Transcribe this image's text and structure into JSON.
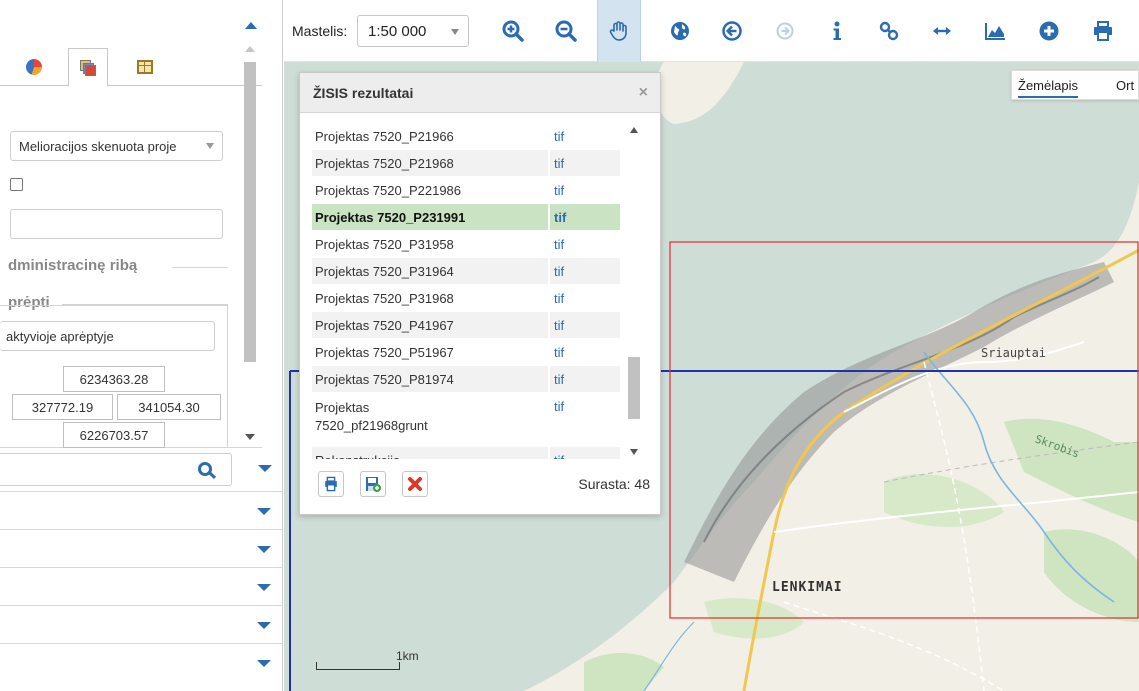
{
  "toolbar": {
    "scale_label": "Mastelis:",
    "scale_value": "1:50 000",
    "tools": [
      {
        "name": "zoom-in-icon"
      },
      {
        "name": "zoom-out-icon"
      },
      {
        "name": "pan-hand-icon"
      },
      {
        "name": "globe-icon"
      },
      {
        "name": "back-icon"
      },
      {
        "name": "forward-icon"
      },
      {
        "name": "info-icon"
      },
      {
        "name": "link-icon"
      },
      {
        "name": "measure-distance-icon"
      },
      {
        "name": "elevation-profile-icon"
      },
      {
        "name": "add-icon"
      },
      {
        "name": "print-icon"
      }
    ],
    "accent_color": "#2b6bb0"
  },
  "left_panel": {
    "layer_select": "Melioracijos skenuota proje",
    "admin_section_title": "dministracinę ribą",
    "extent_section_title": "prėpti",
    "extent_select": "aktyvioje aprėptyje",
    "coords": {
      "north": "6234363.28",
      "west": "327772.19",
      "east": "341054.30",
      "south": "6226703.57"
    },
    "accordion_count": 5
  },
  "map": {
    "map_type_selected": "Žemėlapis",
    "map_type_other": "Ort",
    "place_sriauptai": "Sriauptai",
    "place_town": "LENKIMAI",
    "place_river": "Skrobis",
    "scale_bar_label": "1km"
  },
  "results": {
    "title": "ŽISIS rezultatai",
    "close_glyph": "×",
    "rows": [
      {
        "name": "Projektas 7520_P21966",
        "type": "tif"
      },
      {
        "name": "Projektas 7520_P21968",
        "type": "tif"
      },
      {
        "name": "Projektas 7520_P221986",
        "type": "tif"
      },
      {
        "name": "Projektas 7520_P231991",
        "type": "tif",
        "selected": true
      },
      {
        "name": "Projektas 7520_P31958",
        "type": "tif"
      },
      {
        "name": "Projektas 7520_P31964",
        "type": "tif"
      },
      {
        "name": "Projektas 7520_P31968",
        "type": "tif"
      },
      {
        "name": "Projektas 7520_P41967",
        "type": "tif"
      },
      {
        "name": "Projektas 7520_P51967",
        "type": "tif"
      },
      {
        "name": "Projektas 7520_P81974",
        "type": "tif"
      },
      {
        "name": "Projektas 7520_pf21968grunt",
        "type": "tif",
        "tall": true
      },
      {
        "name": "Rekonstrukcija",
        "type": "tif"
      }
    ],
    "found_label": "Surasta: 48"
  }
}
